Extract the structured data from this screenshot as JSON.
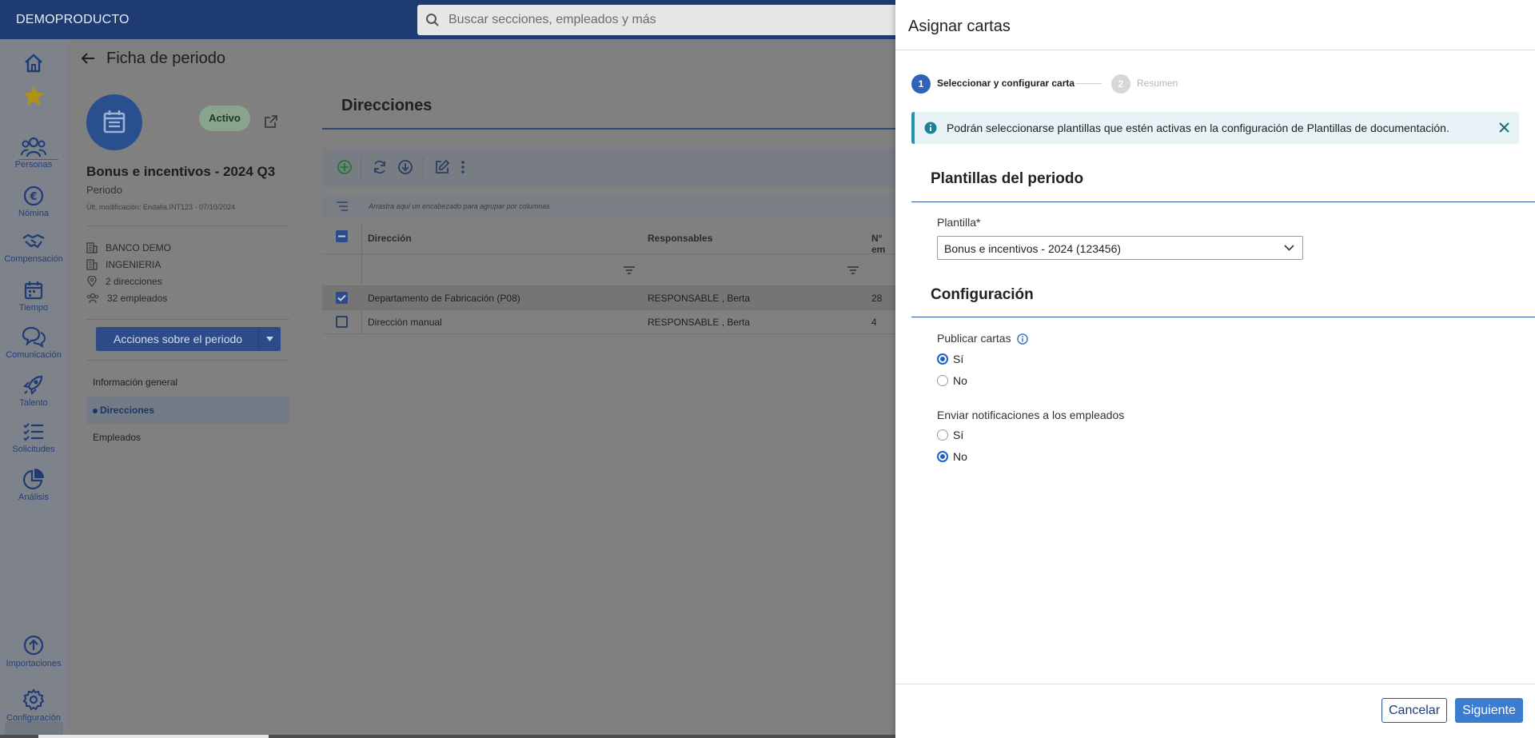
{
  "topbar": {
    "brand": "DEMOPRODUCTO",
    "search_placeholder": "Buscar secciones, empleados y más"
  },
  "rail": {
    "items": [
      {
        "label": "",
        "icon": "home-icon"
      },
      {
        "label": "",
        "icon": "star-icon"
      },
      {
        "label": "Personas",
        "icon": "people-icon"
      },
      {
        "label": "Nómina",
        "icon": "euro-icon"
      },
      {
        "label": "Compensación",
        "icon": "handshake-icon"
      },
      {
        "label": "Tiempo",
        "icon": "calendar-icon"
      },
      {
        "label": "Comunicación",
        "icon": "chat-icon"
      },
      {
        "label": "Talento",
        "icon": "rocket-icon"
      },
      {
        "label": "Solicitudes",
        "icon": "checklist-icon"
      },
      {
        "label": "Análisis",
        "icon": "pie-chart-icon"
      },
      {
        "label": "Importaciones",
        "icon": "upload-icon"
      },
      {
        "label": "Configuración",
        "icon": "gear-icon"
      }
    ]
  },
  "period": {
    "page_title": "Ficha de periodo",
    "status": "Activo",
    "name": "Bonus e incentivos - 2024 Q3",
    "type": "Periodo",
    "last_modified": "Últ. modificación: Endalia.INT123 - 07/10/2024",
    "info": [
      "BANCO DEMO",
      "INGENIERIA",
      "2 direcciones",
      "32 empleados"
    ],
    "actions_label": "Acciones sobre el periodo",
    "nav": [
      "Información general",
      "Direcciones",
      "Empleados"
    ]
  },
  "grid": {
    "title": "Direcciones",
    "group_hint": "Arrastra aquí un encabezado para agrupar por columnas",
    "columns": [
      "Dirección",
      "Responsables",
      "N° em"
    ],
    "rows": [
      {
        "direccion": "Departamento de Fabricación (P08)",
        "responsables": "RESPONSABLE , Berta",
        "num": "28"
      },
      {
        "direccion": "Dirección manual",
        "responsables": "RESPONSABLE , Berta",
        "num": "4"
      }
    ]
  },
  "panel": {
    "title": "Asignar cartas",
    "steps": [
      {
        "num": "1",
        "label": "Seleccionar y configurar carta"
      },
      {
        "num": "2",
        "label": "Resumen"
      }
    ],
    "alert": "Podrán seleccionarse plantillas que estén activas en la configuración de Plantillas de documentación.",
    "sec1_title": "Plantillas del periodo",
    "template_label": "Plantilla*",
    "template_value": "Bonus e incentivos - 2024 (123456)",
    "sec2_title": "Configuración",
    "publish_label": "Publicar cartas",
    "publish_options": [
      "Sí",
      "No"
    ],
    "publish_selected": "Sí",
    "notify_label": "Enviar notificaciones a los empleados",
    "notify_options": [
      "Sí",
      "No"
    ],
    "notify_selected": "No",
    "cancel_label": "Cancelar",
    "next_label": "Siguiente"
  },
  "colors": {
    "primary": "#1f3b74",
    "accent": "#3b7bd0",
    "alert_bg": "#e7f3f7",
    "alert_border": "#1e95b4"
  }
}
